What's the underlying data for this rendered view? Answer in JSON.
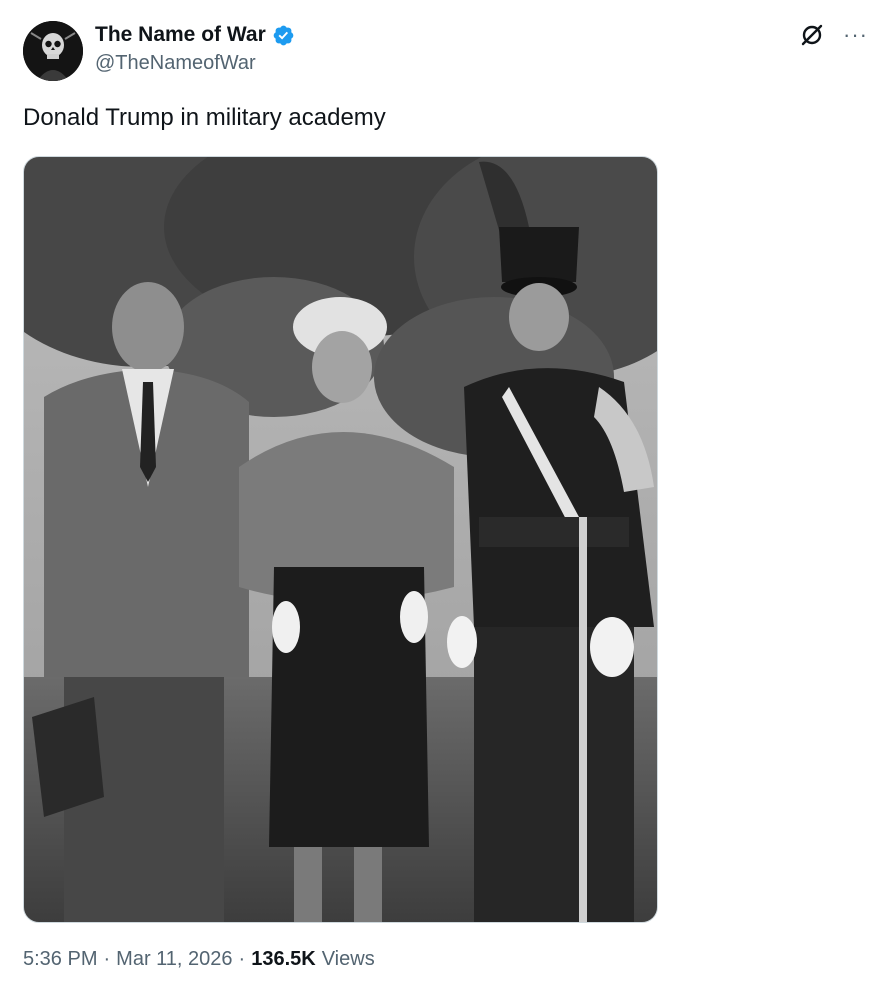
{
  "tweet": {
    "author": {
      "display_name": "The Name of War",
      "handle": "@TheNameofWar",
      "verified": true,
      "avatar_icon": "skull-avatar-icon"
    },
    "text": "Donald Trump in military academy",
    "media": {
      "type": "photo",
      "style": "black-and-white"
    },
    "timestamp": {
      "time": "5:36 PM",
      "date": "Mar 11, 2026"
    },
    "views": {
      "count": "136.5K",
      "label": "Views"
    }
  },
  "actions": {
    "grok_icon": "grok-icon",
    "more_label": "···"
  },
  "colors": {
    "text_primary": "#0f1419",
    "text_secondary": "#536471",
    "verified_blue": "#1d9bf0",
    "border": "#cfd9de"
  }
}
